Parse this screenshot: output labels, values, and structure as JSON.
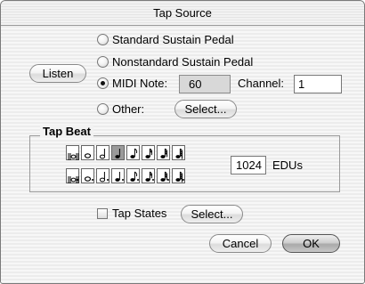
{
  "window": {
    "title": "Tap Source"
  },
  "source": {
    "listen_label": "Listen",
    "options": [
      {
        "label": "Standard Sustain Pedal",
        "selected": false
      },
      {
        "label": "Nonstandard Sustain Pedal",
        "selected": false
      },
      {
        "label": "MIDI Note:",
        "selected": true
      },
      {
        "label": "Other:",
        "selected": false
      }
    ],
    "midi_note_value": "60",
    "channel_label": "Channel:",
    "channel_value": "1",
    "other_select_label": "Select..."
  },
  "tap_beat": {
    "title": "Tap Beat",
    "row1_icons": [
      "double-whole-note-icon",
      "whole-note-icon",
      "half-note-icon",
      "quarter-note-icon",
      "eighth-note-icon",
      "sixteenth-note-icon",
      "thirty-second-note-icon",
      "sixty-fourth-note-icon"
    ],
    "row2_icons": [
      "dotted-double-whole-note-icon",
      "dotted-whole-note-icon",
      "dotted-half-note-icon",
      "dotted-quarter-note-icon",
      "dotted-eighth-note-icon",
      "dotted-sixteenth-note-icon",
      "dotted-thirty-second-note-icon",
      "dotted-sixty-fourth-note-icon"
    ],
    "selected": "quarter-note-icon",
    "edus_value": "1024",
    "edus_label": "EDUs"
  },
  "tap_states": {
    "label": "Tap States",
    "checked": false,
    "select_label": "Select..."
  },
  "footer": {
    "cancel_label": "Cancel",
    "ok_label": "OK"
  }
}
